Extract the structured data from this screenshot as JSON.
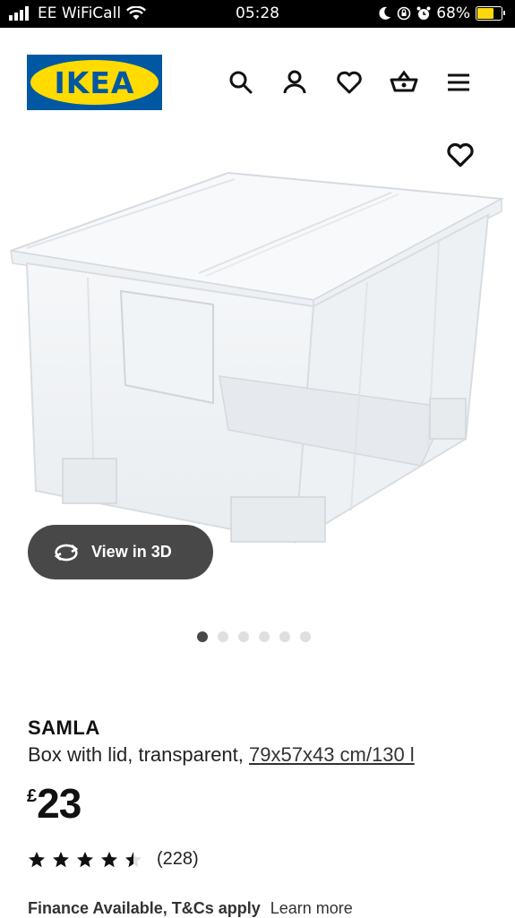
{
  "status_bar": {
    "carrier": "EE WiFiCall",
    "time": "05:28",
    "battery": "68%",
    "battery_level": 0.68,
    "battery_color": "#ffd60a"
  },
  "header": {
    "logo_text": "IKEA",
    "logo_colors": {
      "blue": "#0058a3",
      "yellow": "#ffdb00"
    },
    "icons": [
      "search-icon",
      "account-icon",
      "wishlist-icon",
      "basket-icon",
      "menu-icon"
    ]
  },
  "gallery": {
    "view_3d_label": "View in 3D",
    "image_count": 6,
    "active_index": 0
  },
  "product": {
    "name": "SAMLA",
    "description": "Box with lid, transparent, ",
    "measurement": "79x57x43 cm/130 l",
    "currency": "£",
    "price": "23",
    "rating": 4.5,
    "review_count": "(228)"
  },
  "finance": {
    "text": "Finance Available, T&Cs apply",
    "link": "Learn more"
  }
}
